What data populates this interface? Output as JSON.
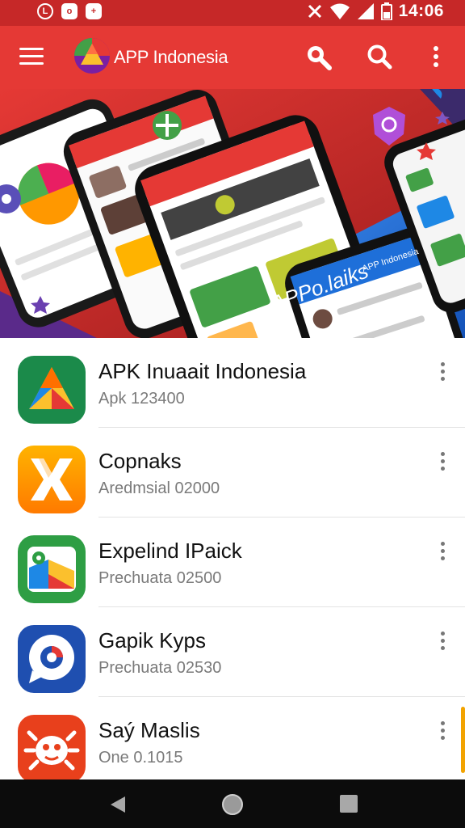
{
  "status_bar": {
    "time": "14:06",
    "left_icons": [
      "L",
      "o",
      "+"
    ],
    "right_icons": [
      "x-icon",
      "wifi-icon",
      "signal-icon",
      "battery-icon"
    ]
  },
  "app_bar": {
    "title": "APP Indonesia",
    "actions": [
      "search-icon",
      "search-icon",
      "more-vert-icon"
    ]
  },
  "banner": {
    "texts": [
      "APPo.laiks",
      "APP Indonesia"
    ]
  },
  "apps": [
    {
      "name": "APK Inuaait Indonesia",
      "subtitle": "Apk 123400",
      "icon": "drive-triangle-icon"
    },
    {
      "name": "Copnaks",
      "subtitle": "Aredmsial 02000",
      "icon": "x-app-icon"
    },
    {
      "name": "Expelind IPaick",
      "subtitle": "Prechuata 02500",
      "icon": "maps-icon"
    },
    {
      "name": "Gapik Kyps",
      "subtitle": "Prechuata 02530",
      "icon": "chat-bubble-icon"
    },
    {
      "name": "Saý Maslis",
      "subtitle": "One 0.1015",
      "icon": "bug-icon"
    }
  ],
  "colors": {
    "status_bar": "#c62828",
    "app_bar": "#e53935",
    "banner_red": "#d32f2f",
    "banner_blue": "#1e6fd9",
    "nav_bar": "#0c0c0c"
  }
}
